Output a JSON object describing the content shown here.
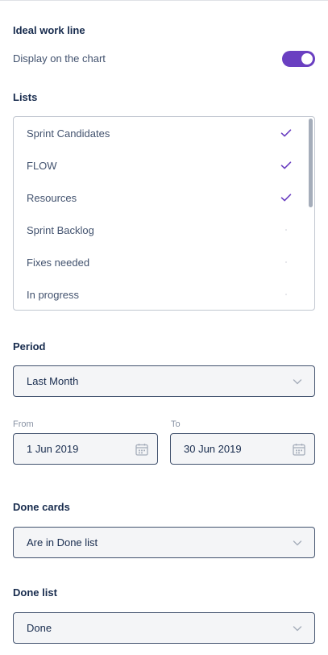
{
  "ideal_work_line": {
    "heading": "Ideal work line",
    "display_label": "Display on the chart",
    "display_on": true
  },
  "lists": {
    "heading": "Lists",
    "items": [
      {
        "label": "Sprint Candidates",
        "checked": true
      },
      {
        "label": "FLOW",
        "checked": true
      },
      {
        "label": "Resources",
        "checked": true
      },
      {
        "label": "Sprint Backlog",
        "checked": false
      },
      {
        "label": "Fixes needed",
        "checked": false
      },
      {
        "label": "In progress",
        "checked": false
      }
    ]
  },
  "period": {
    "heading": "Period",
    "selected": "Last Month",
    "from_label": "From",
    "from_value": "1 Jun 2019",
    "to_label": "To",
    "to_value": "30 Jun 2019"
  },
  "done_cards": {
    "heading": "Done cards",
    "selected": "Are in Done list"
  },
  "done_list": {
    "heading": "Done list",
    "selected": "Done"
  },
  "colors": {
    "accent": "#6a3fc1",
    "text": "#172b4d",
    "muted": "#8993a4"
  }
}
